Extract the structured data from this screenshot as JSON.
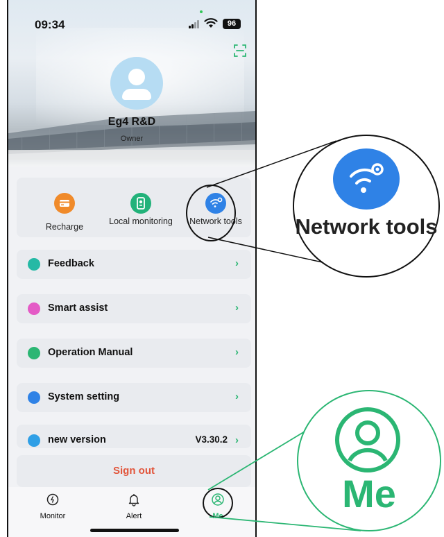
{
  "status_bar": {
    "time": "09:34",
    "battery": "96"
  },
  "profile": {
    "name": "Eg4 R&D",
    "role": "Owner"
  },
  "quick_actions": [
    {
      "label": "Recharge",
      "icon": "card-icon",
      "color": "#f08a2a"
    },
    {
      "label": "Local monitoring",
      "icon": "device-icon",
      "color": "#22b27a"
    },
    {
      "label": "Network tools",
      "icon": "wifi-gear-icon",
      "color": "#2f82e6"
    }
  ],
  "menu": {
    "feedback": {
      "label": "Feedback",
      "icon": "feedback-icon",
      "color": "#25b9a5"
    },
    "smart_assist": {
      "label": "Smart assist",
      "icon": "assist-icon",
      "color": "#e45bc6"
    },
    "operation_manual": {
      "label": "Operation Manual",
      "icon": "manual-icon",
      "color": "#2bb673"
    },
    "system_setting": {
      "label": "System setting",
      "icon": "settings-icon",
      "color": "#2f82e6"
    },
    "new_version": {
      "label": "new version",
      "value": "V3.30.2",
      "icon": "info-icon",
      "color": "#2f9fe6"
    }
  },
  "sign_out": "Sign out",
  "tabs": [
    {
      "label": "Monitor",
      "icon": "monitor-icon"
    },
    {
      "label": "Alert",
      "icon": "bell-icon"
    },
    {
      "label": "Me",
      "icon": "person-icon",
      "active": true
    }
  ],
  "callouts": {
    "network_label": "Network tools",
    "me_label": "Me"
  },
  "colors": {
    "accent": "#2bb673",
    "signout": "#e2553b"
  }
}
